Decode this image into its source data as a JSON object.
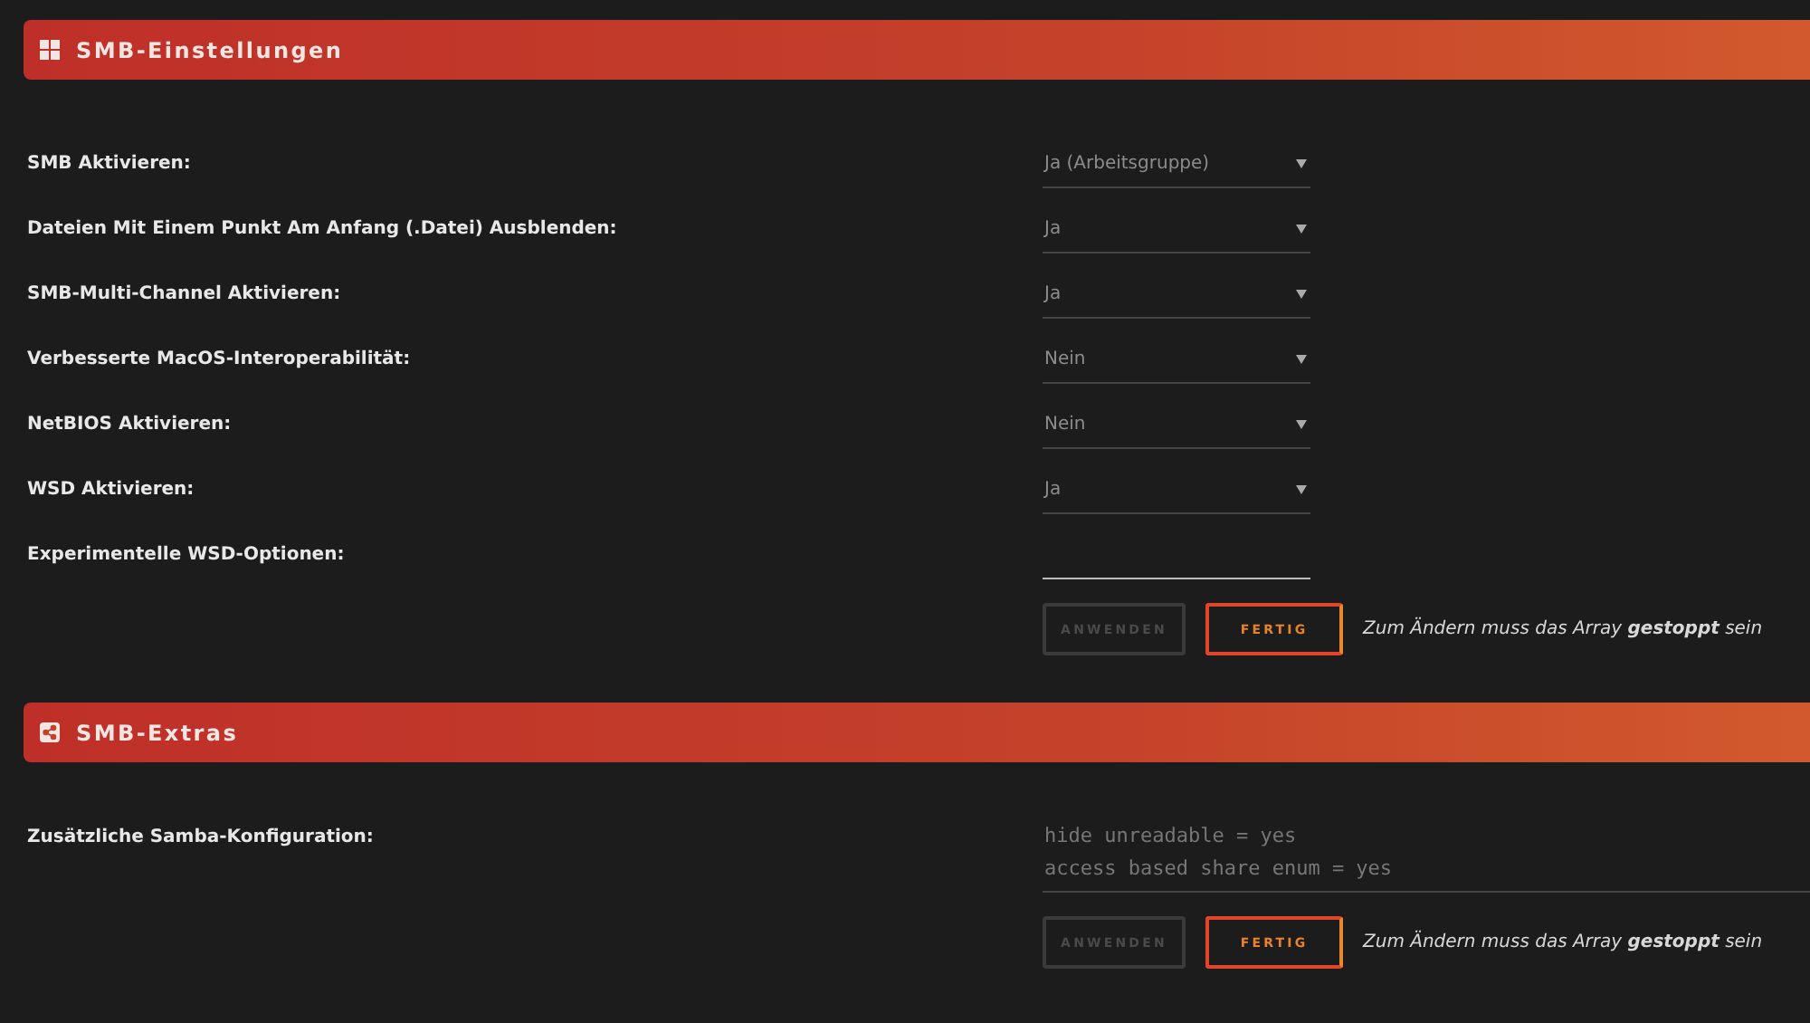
{
  "sections": [
    {
      "title": "SMB-Einstellungen",
      "kind": "windows",
      "fields": [
        {
          "label": "SMB Aktivieren:",
          "kind": "select",
          "value": "Ja (Arbeitsgruppe)"
        },
        {
          "label": "Dateien Mit Einem Punkt Am Anfang (.Datei) Ausblenden:",
          "kind": "select",
          "value": "Ja"
        },
        {
          "label": "SMB-Multi-Channel Aktivieren:",
          "kind": "select",
          "value": "Ja"
        },
        {
          "label": "Verbesserte MacOS-Interoperabilität:",
          "kind": "select",
          "value": "Nein"
        },
        {
          "label": "NetBIOS Aktivieren:",
          "kind": "select",
          "value": "Nein"
        },
        {
          "label": "WSD Aktivieren:",
          "kind": "select",
          "value": "Ja"
        },
        {
          "label": "Experimentelle WSD-Optionen:",
          "kind": "text"
        }
      ],
      "buttons": [
        {
          "label": "ANWENDEN",
          "disabled": true
        },
        {
          "label": "FERTIG",
          "disabled": false
        }
      ],
      "note": "Zum Ändern muss das Array **gestoppt** sein"
    },
    {
      "title": "SMB-Extras",
      "kind": "share",
      "fields": [
        {
          "label": "Zusätzliche Samba-Konfiguration:",
          "kind": "textarea",
          "value": "hide unreadable = yes\naccess based share enum = yes"
        }
      ],
      "buttons": [
        {
          "label": "ANWENDEN",
          "disabled": true
        },
        {
          "label": "FERTIG",
          "disabled": false
        }
      ],
      "note": "Zum Ändern muss das Array **gestoppt** sein"
    }
  ]
}
